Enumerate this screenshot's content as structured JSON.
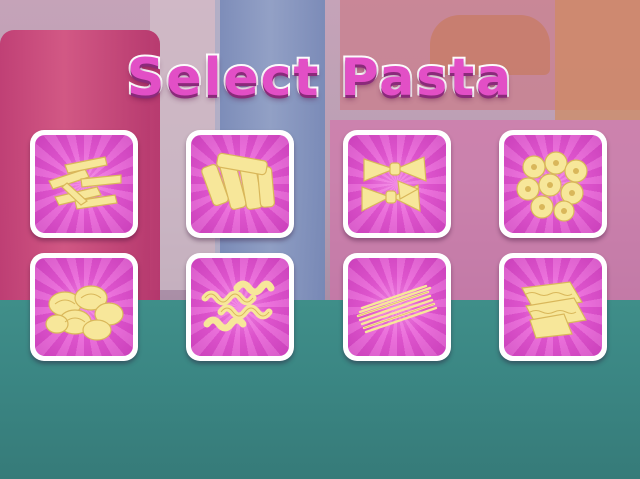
{
  "screen": {
    "title": "Select Pasta"
  },
  "pasta_options": [
    {
      "icon": "penne-pasta-icon"
    },
    {
      "icon": "rigatoni-pasta-icon"
    },
    {
      "icon": "farfalle-pasta-icon"
    },
    {
      "icon": "tortellini-pasta-icon"
    },
    {
      "icon": "shell-pasta-icon"
    },
    {
      "icon": "fusilli-pasta-icon"
    },
    {
      "icon": "spaghetti-pasta-icon"
    },
    {
      "icon": "lasagna-pasta-icon"
    }
  ],
  "colors": {
    "title_fill": "#e24fc6",
    "title_outline": "#ffffff",
    "tile_pink": "#e86bd8",
    "tile_border": "#ffffff",
    "pasta_yellow": "#f7e79a",
    "floor_teal": "#3c8a86"
  }
}
